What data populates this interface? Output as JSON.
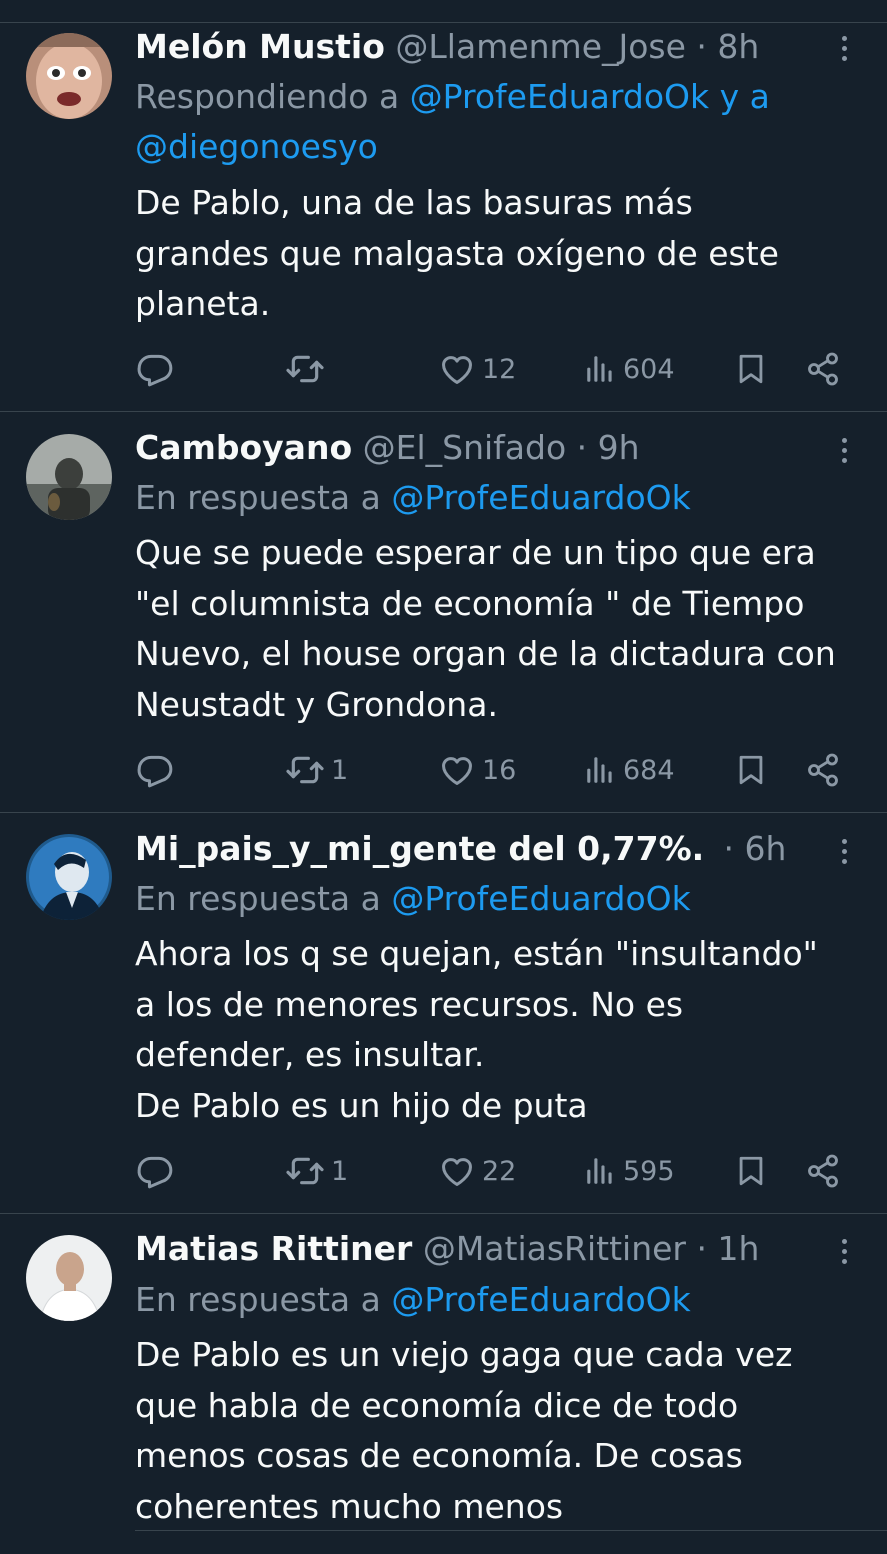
{
  "tweets": [
    {
      "name": "Melón Mustio",
      "handle": "@Llamenme_Jose",
      "time": "8h",
      "reply_prefix": "Respondiendo a ",
      "mention1": "@ProfeEduardoOk",
      "reply_join": " y a",
      "mention2": "@diegonoesyo",
      "text": "De Pablo, una de las basuras más\ngrandes que malgasta oxígeno de este\nplaneta.",
      "retweets": "",
      "likes": "12",
      "views": "604"
    },
    {
      "name": "Camboyano",
      "handle": "@El_Snifado",
      "time": "9h",
      "reply_prefix": "En respuesta a ",
      "mention1": "@ProfeEduardoOk",
      "text": "Que se puede esperar de un tipo que era\n\"el columnista de economía \" de Tiempo\nNuevo, el house organ de la dictadura con\nNeustadt y Grondona.",
      "retweets": "1",
      "likes": "16",
      "views": "684"
    },
    {
      "name": "Mi_pais_y_mi_gente del 0,77%. ...",
      "handle": "",
      "time": "6h",
      "reply_prefix": "En respuesta a ",
      "mention1": "@ProfeEduardoOk",
      "text": "Ahora los q se quejan, están \"insultando\"\na los de menores recursos. No es\ndefender, es insultar.\nDe Pablo es un hijo de puta",
      "retweets": "1",
      "likes": "22",
      "views": "595"
    },
    {
      "name": "Matias Rittiner",
      "handle": "@MatiasRittiner",
      "time": "1h",
      "reply_prefix": "En respuesta a ",
      "mention1": "@ProfeEduardoOk",
      "text": "De Pablo es un viejo gaga que cada vez\nque habla de economía dice de todo\nmenos cosas de economía. De cosas\ncoherentes mucho menos"
    }
  ],
  "colors": {
    "background": "#15202b",
    "text": "#f7f9f9",
    "secondary": "#8b98a5",
    "accent": "#1d9bf0",
    "divider": "#38444d"
  },
  "icons": [
    "reply-icon",
    "retweet-icon",
    "like-icon",
    "views-icon",
    "bookmark-icon",
    "share-icon",
    "more-icon"
  ]
}
